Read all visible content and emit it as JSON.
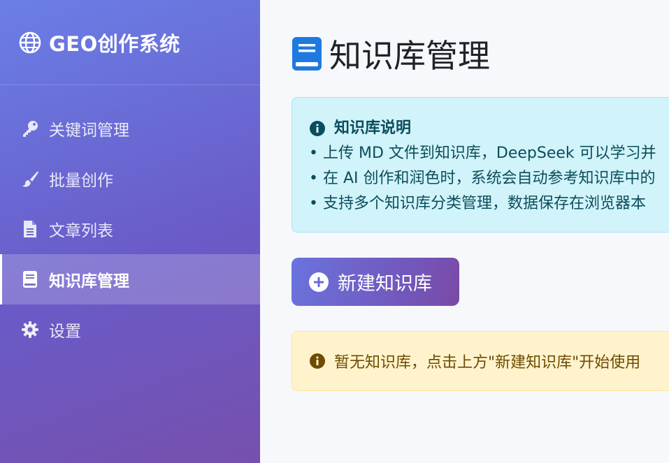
{
  "sidebar": {
    "brand": {
      "icon": "globe-icon",
      "title": "GEO创作系统"
    },
    "items": [
      {
        "icon": "key-icon",
        "label": "关键词管理",
        "active": false
      },
      {
        "icon": "brush-icon",
        "label": "批量创作",
        "active": false
      },
      {
        "icon": "file-icon",
        "label": "文章列表",
        "active": false
      },
      {
        "icon": "book-icon",
        "label": "知识库管理",
        "active": true
      },
      {
        "icon": "gear-icon",
        "label": "设置",
        "active": false
      }
    ]
  },
  "main": {
    "title": "知识库管理",
    "title_icon": "book-icon",
    "info": {
      "icon": "info-icon",
      "heading": "知识库说明",
      "lines": [
        "• 上传 MD 文件到知识库，DeepSeek 可以学习并",
        "• 在 AI 创作和润色时，系统会自动参考知识库中的",
        "• 支持多个知识库分类管理，数据保存在浏览器本"
      ]
    },
    "new_button": {
      "icon": "plus-circle-icon",
      "label": "新建知识库"
    },
    "empty_notice": {
      "icon": "info-icon",
      "text": "暂无知识库，点击上方\"新建知识库\"开始使用"
    }
  },
  "colors": {
    "sidebar_gradient_start": "#6a7fe6",
    "sidebar_gradient_end": "#7650ad",
    "info_bg": "#d1f3fa",
    "info_text": "#0b4d5c",
    "warn_bg": "#fff3cd",
    "warn_text": "#6e4b00",
    "title_icon": "#1f7ae0"
  }
}
